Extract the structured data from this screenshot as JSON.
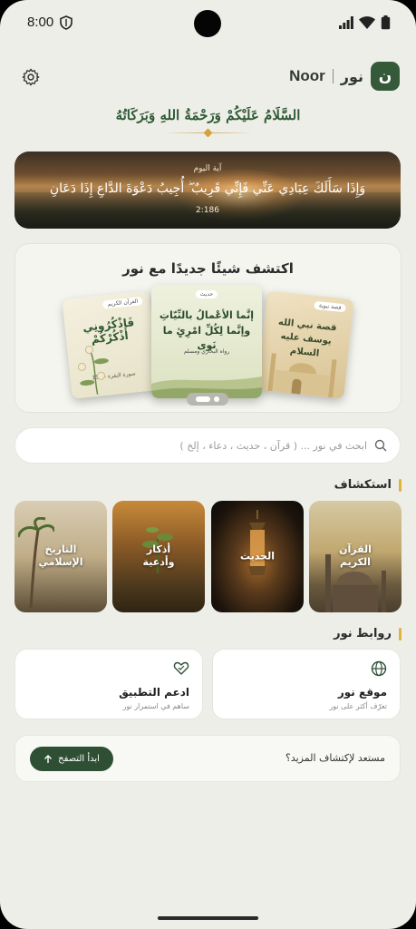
{
  "status_bar": {
    "time": "8:00"
  },
  "header": {
    "brand_ar": "نور",
    "brand_en": "Noor",
    "logo_letter": "ن"
  },
  "greeting": "السَّلَامُ عَلَيْكُمْ وَرَحْمَةُ اللهِ وَبَرَكَاتُهُ",
  "verse_card": {
    "label": "آية اليوم",
    "text": "وَإِذَا سَأَلَكَ عِبَادِي عَنِّي فَإِنِّي قَرِيبٌ ۖ أُجِيبُ دَعْوَةَ الدَّاعِ إِذَا دَعَانِ",
    "reference": "2:186"
  },
  "discover": {
    "title": "اكتشف شيئًا جديدًا مع نور",
    "cards": {
      "left": {
        "tag": "القرآن الكريم",
        "text": "فَاذْكُرُونِي أَذْكُرْكُمْ",
        "source": "سورة البقرة - 152"
      },
      "middle": {
        "tag": "حديث",
        "text": "إنَّما الأعْمالُ بالنِّيّاتِ وإنَّما لِكُلِّ امْرِئٍ ما نَوى",
        "source": "رواه البخاري ومسلم"
      },
      "right": {
        "tag": "قصة نبوية",
        "text": "قصة نبي الله يوسف عليه السلام",
        "source": ""
      }
    }
  },
  "search": {
    "placeholder": "ابحث في نور ... ( قرآن ، حديث ، دعاء ، إلخ )"
  },
  "explore": {
    "title": "استكشاف",
    "tiles": [
      {
        "label": "القرآن\nالكريم"
      },
      {
        "label": "الحديث"
      },
      {
        "label": "أذكار\nوأدعية"
      },
      {
        "label": "التاريخ\nالإسلامي"
      }
    ]
  },
  "links": {
    "title": "روابط نور",
    "website": {
      "title": "موقع نور",
      "subtitle": "تعرّف أكثر على نور"
    },
    "support": {
      "title": "ادعم التطبيق",
      "subtitle": "ساهم في استمرار نور"
    }
  },
  "cta": {
    "text": "مستعد لإكتشاف المزيد؟",
    "button": "ابدأ التصفح"
  },
  "colors": {
    "accent": "#2f4f35",
    "gold": "#e0b43a",
    "background": "#eeeee8"
  }
}
